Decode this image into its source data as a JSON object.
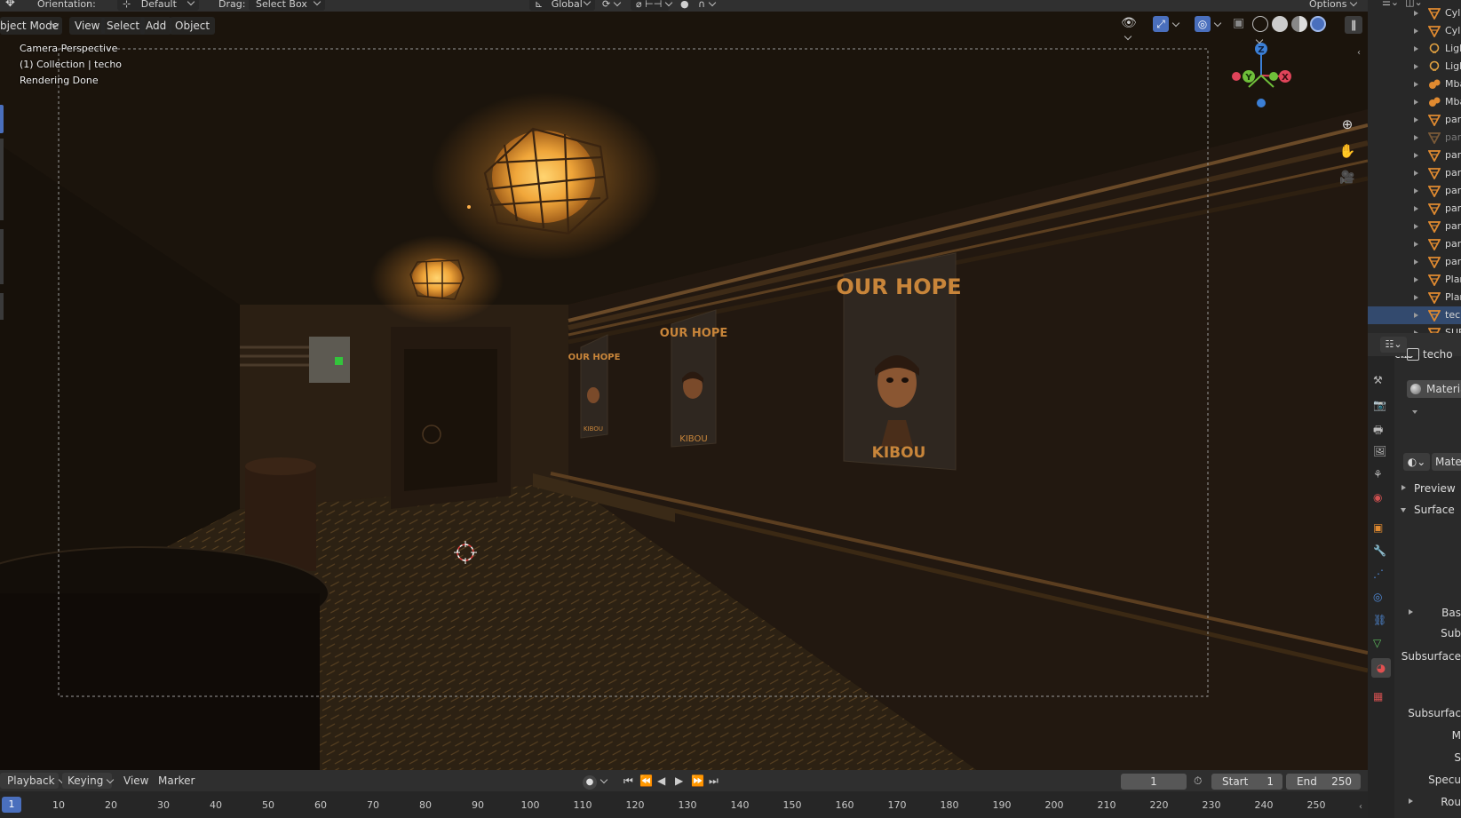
{
  "header": {
    "orientation_label": "Orientation:",
    "orientation_value": "Default",
    "drag_label": "Drag:",
    "drag_value": "Select Box",
    "transform_value": "Global",
    "options_label": "Options"
  },
  "viewport_header": {
    "mode": "bject Mode",
    "menus": [
      "View",
      "Select",
      "Add",
      "Object"
    ]
  },
  "viewport_overlay": {
    "line1": "Camera Perspective",
    "line2": "(1) Collection | techo",
    "line3": "Rendering Done"
  },
  "scene_text": {
    "poster_big_title": "OUR HOPE",
    "poster_big_sub": "KIBOU",
    "poster_mid_title": "OUR HOPE",
    "poster_mid_sub": "KIBOU",
    "poster_small_title": "OUR HOPE",
    "poster_small_sub": "KIBOU"
  },
  "gizmo": {
    "x": "X",
    "y": "Y",
    "z": "Z"
  },
  "timeline": {
    "menus": [
      "Playback",
      "Keying",
      "View",
      "Marker"
    ],
    "current_frame": "1",
    "start_label": "Start",
    "start_value": "1",
    "end_label": "End",
    "end_value": "250",
    "ticks": [
      "10",
      "20",
      "30",
      "40",
      "50",
      "60",
      "70",
      "80",
      "90",
      "100",
      "110",
      "120",
      "130",
      "140",
      "150",
      "160",
      "170",
      "180",
      "190",
      "200",
      "210",
      "220",
      "230",
      "240",
      "250"
    ]
  },
  "outliner": {
    "rows": [
      {
        "label": "Cyl",
        "type": "mesh"
      },
      {
        "label": "Cyli",
        "type": "mesh"
      },
      {
        "label": "Ligh",
        "type": "light"
      },
      {
        "label": "Ligh",
        "type": "light"
      },
      {
        "label": "Mba",
        "type": "meta"
      },
      {
        "label": "Mba",
        "type": "meta"
      },
      {
        "label": "pare",
        "type": "mesh"
      },
      {
        "label": "pare",
        "type": "mesh-dim"
      },
      {
        "label": "pare",
        "type": "mesh"
      },
      {
        "label": "pare",
        "type": "mesh"
      },
      {
        "label": "pare",
        "type": "mesh"
      },
      {
        "label": "pare",
        "type": "mesh"
      },
      {
        "label": "pare",
        "type": "mesh"
      },
      {
        "label": "pare",
        "type": "mesh"
      },
      {
        "label": "pare",
        "type": "mesh"
      },
      {
        "label": "Plan",
        "type": "mesh"
      },
      {
        "label": "Plan",
        "type": "mesh"
      },
      {
        "label": "tech",
        "type": "mesh-active"
      },
      {
        "label": "SUELO",
        "type": "mesh"
      }
    ]
  },
  "properties": {
    "object_name": "techo",
    "material_slot": "Materia",
    "material_browse": "Mate",
    "preview_label": "Preview",
    "surface_label": "Surface",
    "fields": [
      "Bas",
      "Sub",
      "Subsurface",
      "Subsurfac",
      "M",
      "S",
      "Specu",
      "Rou"
    ]
  },
  "colors": {
    "accent_blue": "#4a6fbd",
    "axis_x": "#e0445a",
    "axis_y": "#6fbf3a",
    "axis_z": "#3b7fd6",
    "lamp_glow": "#f0a63a"
  }
}
